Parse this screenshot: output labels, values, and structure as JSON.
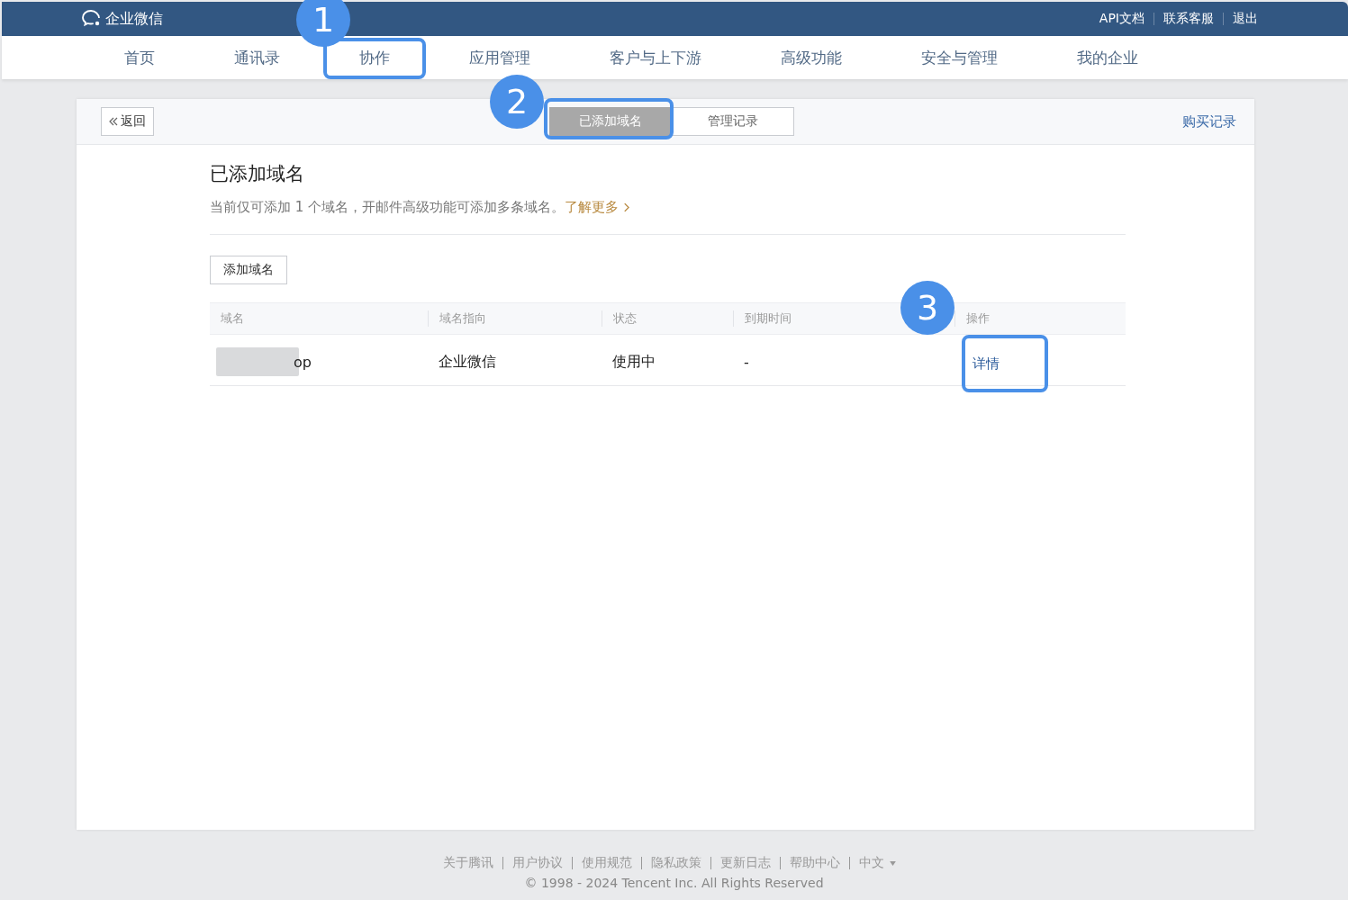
{
  "topbar": {
    "logo": "企业微信",
    "links": [
      "API文档",
      "联系客服",
      "退出"
    ]
  },
  "nav": [
    {
      "label": "首页"
    },
    {
      "label": "通讯录"
    },
    {
      "label": "协作",
      "callout": "1"
    },
    {
      "label": "应用管理"
    },
    {
      "label": "客户与上下游"
    },
    {
      "label": "高级功能"
    },
    {
      "label": "安全与管理"
    },
    {
      "label": "我的企业"
    }
  ],
  "panel": {
    "back": "返回",
    "tabs": [
      {
        "label": "已添加域名",
        "selected": true,
        "callout": "2"
      },
      {
        "label": "管理记录",
        "selected": false
      }
    ],
    "purchase_link": "购买记录",
    "title": "已添加域名",
    "description": "当前仅可添加 1 个域名，开邮件高级功能可添加多条域名。",
    "learn_more": "了解更多",
    "add_button": "添加域名",
    "table": {
      "columns": [
        "域名",
        "域名指向",
        "状态",
        "到期时间",
        "操作"
      ],
      "rows": [
        {
          "domain": "op",
          "target": "企业微信",
          "status": "使用中",
          "expiry": "-",
          "action": "详情",
          "action_callout": "3"
        }
      ]
    }
  },
  "footer": {
    "links": [
      "关于腾讯",
      "用户协议",
      "使用规范",
      "隐私政策",
      "更新日志",
      "帮助中心"
    ],
    "language": "中文",
    "copyright": "© 1998 - 2024 Tencent Inc. All Rights Reserved"
  }
}
